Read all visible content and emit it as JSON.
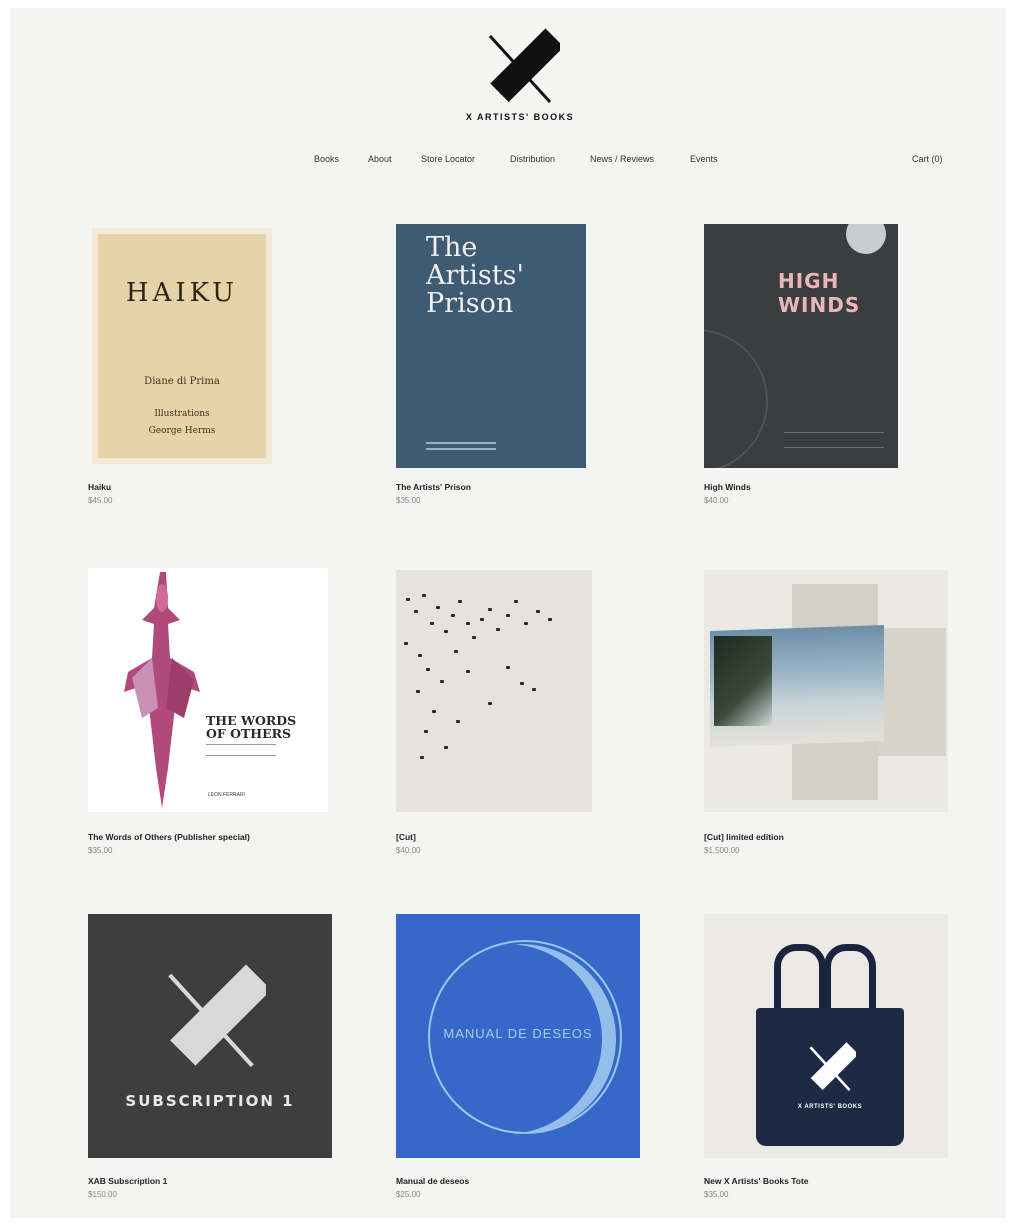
{
  "brand": {
    "name": "X ARTISTS' BOOKS"
  },
  "nav": {
    "links": [
      "Books",
      "About",
      "Store Locator",
      "Distribution",
      "News / Reviews",
      "Events"
    ],
    "cart": "Cart (0)"
  },
  "products": [
    {
      "title": "Haiku",
      "price": "$45.00",
      "cover_text": [
        "HAIKU",
        "Diane di Prima",
        "Illustrations",
        "George Herms"
      ]
    },
    {
      "title": "The Artists' Prison",
      "price": "$35.00",
      "cover_text": [
        "The",
        "Artists'",
        "Prison"
      ]
    },
    {
      "title": "High Winds",
      "price": "$40.00",
      "cover_text": [
        "HIGH",
        "WINDS"
      ]
    },
    {
      "title": "The Words of Others (Publisher special)",
      "price": "$35.00",
      "cover_text": [
        "THE WORDS",
        "OF OTHERS",
        "LEON FERRARI"
      ]
    },
    {
      "title": "[Cut]",
      "price": "$40.00",
      "cover_text": []
    },
    {
      "title": "[Cut] limited edition",
      "price": "$1,500.00",
      "cover_text": []
    },
    {
      "title": "XAB Subscription 1",
      "price": "$150.00",
      "cover_text": [
        "SUBSCRIPTION 1"
      ]
    },
    {
      "title": "Manual de deseos",
      "price": "$25.00",
      "cover_text": [
        "MANUAL DE DESEOS"
      ]
    },
    {
      "title": "New X Artists' Books Tote",
      "price": "$35.00",
      "cover_text": [
        "X ARTISTS' BOOKS"
      ]
    }
  ],
  "colors": {
    "background": "#f4f4f3",
    "text": "#222222",
    "price": "#888888"
  }
}
